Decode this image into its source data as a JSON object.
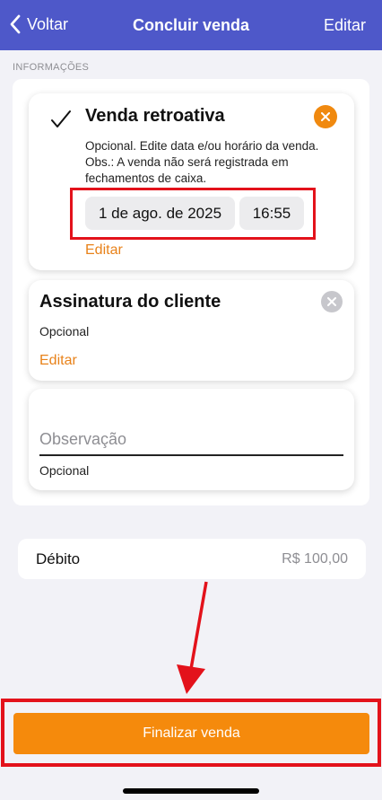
{
  "navbar": {
    "back_label": "Voltar",
    "title": "Concluir venda",
    "edit_label": "Editar"
  },
  "section": {
    "label": "INFORMAÇÕES"
  },
  "retroactive": {
    "title": "Venda retroativa",
    "description": "Opcional. Edite data e/ou horário da venda. Obs.: A venda não será registrada em fechamentos de caixa.",
    "date": "1 de ago. de 2025",
    "time": "16:55",
    "edit_label": "Editar",
    "checked": true
  },
  "signature": {
    "title": "Assinatura do cliente",
    "subtitle": "Opcional",
    "edit_label": "Editar"
  },
  "observation": {
    "placeholder": "Observação",
    "value": "",
    "helper": "Opcional"
  },
  "payment": {
    "method": "Débito",
    "amount": "R$ 100,00"
  },
  "footer": {
    "finalize_label": "Finalizar venda"
  },
  "colors": {
    "navbar": "#4e58c9",
    "accent_orange": "#f58a0c",
    "highlight_red": "#e3121b"
  }
}
